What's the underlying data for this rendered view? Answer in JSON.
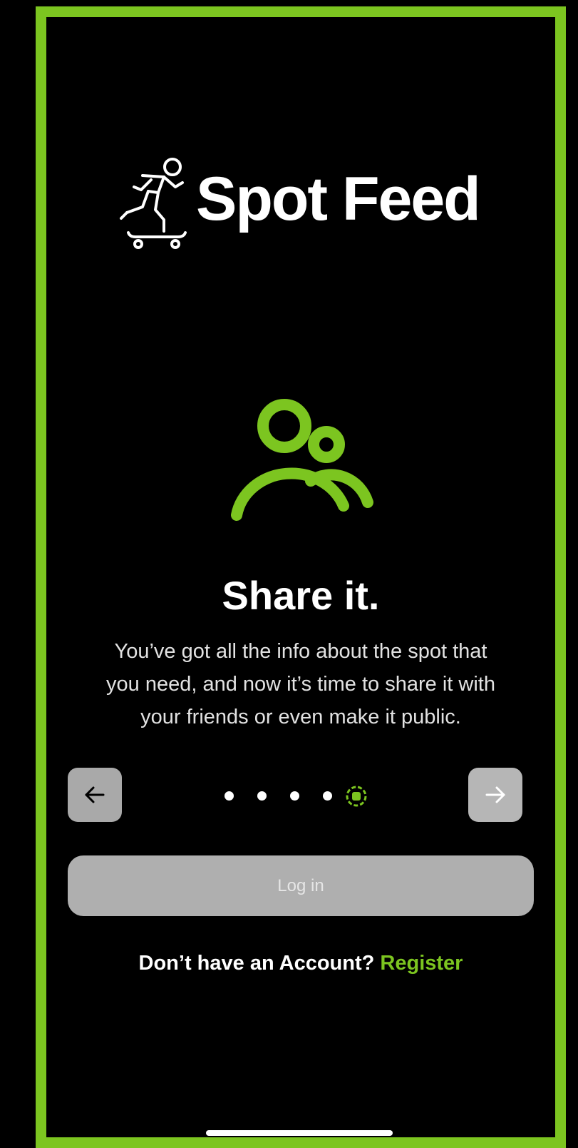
{
  "app": {
    "name": "Spot Feed",
    "accent_color": "#7cc520",
    "logo_icon": "skateboarder-icon"
  },
  "onboarding": {
    "hero_icon": "users-icon",
    "headline": "Share it.",
    "body": "You’ve got all the info about the spot that\nyou need, and now it’s time to share it with\nyour friends  or even make it public.",
    "prev_icon": "arrow-left-icon",
    "next_icon": "arrow-right-icon",
    "page_count": 5,
    "current_page": 5
  },
  "actions": {
    "login_label": "Log in",
    "register_prompt": "Don’t have an Account?",
    "register_label": "Register"
  }
}
